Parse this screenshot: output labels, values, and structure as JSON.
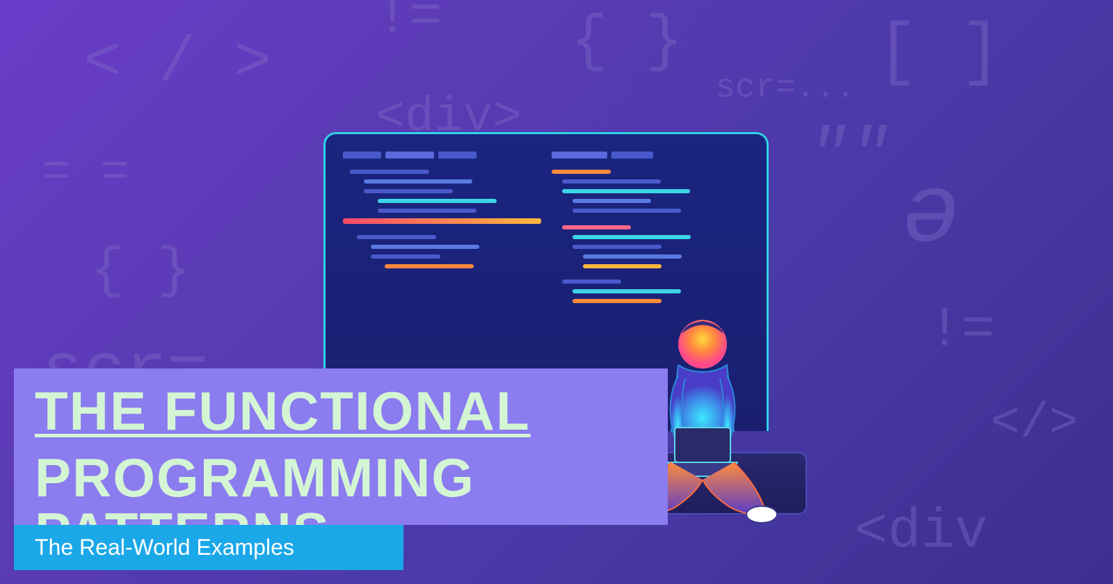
{
  "title": {
    "line1": "THE FUNCTIONAL",
    "line2": "PROGRAMMING PATTERNS"
  },
  "subtitle": "The Real-World Examples",
  "bg_texts": {
    "closeTag": "< / >",
    "bang": "!=",
    "brace1": "{ }",
    "bracket": "[ ]",
    "scr1": "scr=...",
    "divTag": "<div>",
    "equals": "= =",
    "quotes": "\"\"",
    "partial": "ə",
    "brace2": "{ }",
    "scr2": "scr=",
    "bang2": "!=",
    "closeTag2": "</>",
    "divClose": "<div"
  },
  "colors": {
    "titleBg": "#8b7cf0",
    "subtitleBg": "#1ba8e8",
    "titleText": "#d4f5d4",
    "laptopBorder": "#2dd4e8"
  }
}
